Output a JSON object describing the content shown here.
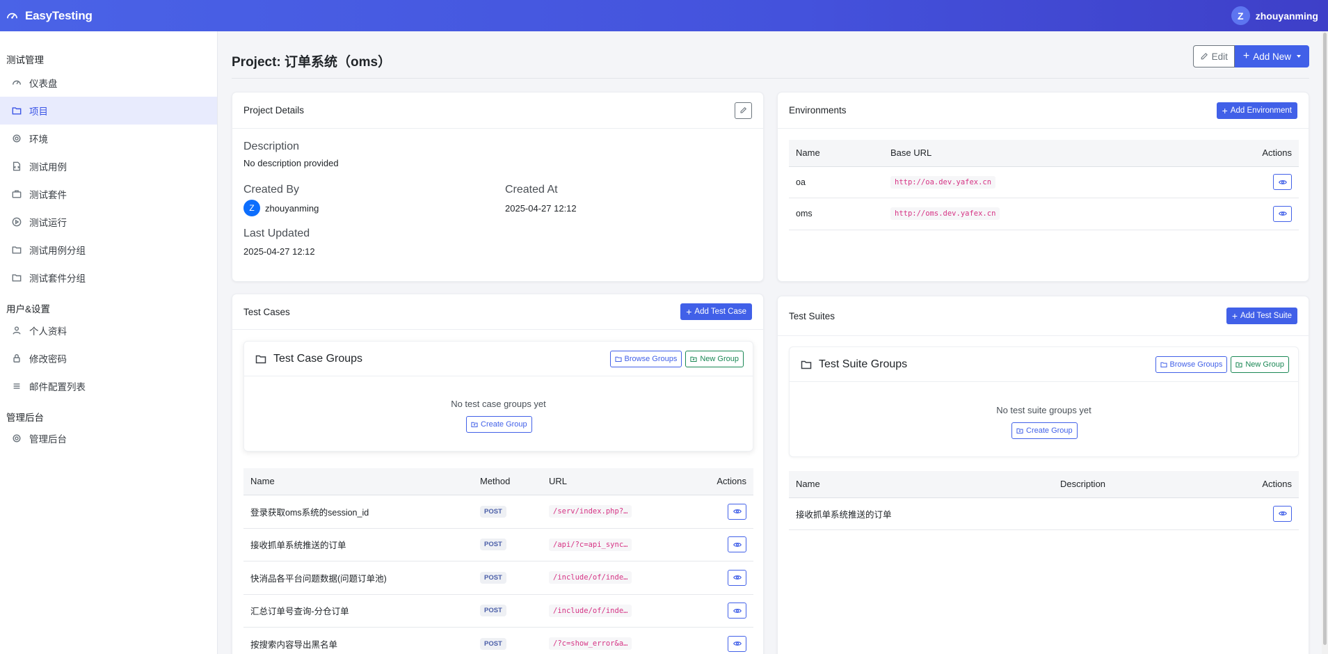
{
  "app": {
    "brand": "EasyTesting",
    "user_initial": "Z",
    "username": "zhouyanming"
  },
  "sidebar": {
    "sections": [
      {
        "title": "测试管理",
        "items": [
          {
            "label": "仪表盘",
            "icon": "dashboard-icon"
          },
          {
            "label": "项目",
            "icon": "folder-icon",
            "active": true
          },
          {
            "label": "环境",
            "icon": "gear-icon"
          },
          {
            "label": "测试用例",
            "icon": "file-code-icon"
          },
          {
            "label": "测试套件",
            "icon": "suitcase-icon"
          },
          {
            "label": "测试运行",
            "icon": "play-circle-icon"
          },
          {
            "label": "测试用例分组",
            "icon": "folder-icon"
          },
          {
            "label": "测试套件分组",
            "icon": "folder-icon"
          }
        ]
      },
      {
        "title": "用户&设置",
        "items": [
          {
            "label": "个人资料",
            "icon": "person-icon"
          },
          {
            "label": "修改密码",
            "icon": "lock-icon"
          },
          {
            "label": "邮件配置列表",
            "icon": "list-icon"
          }
        ]
      },
      {
        "title": "管理后台",
        "items": [
          {
            "label": "管理后台",
            "icon": "gear-icon"
          }
        ]
      }
    ]
  },
  "page": {
    "title": "Project: 订单系统（oms）",
    "edit_label": "Edit",
    "add_new_label": "Add New"
  },
  "details": {
    "title": "Project Details",
    "description_label": "Description",
    "description_value": "No description provided",
    "created_by_label": "Created By",
    "created_by_initial": "Z",
    "created_by_value": "zhouyanming",
    "created_at_label": "Created At",
    "created_at_value": "2025-04-27 12:12",
    "updated_label": "Last Updated",
    "updated_value": "2025-04-27 12:12"
  },
  "environments": {
    "title": "Environments",
    "add_label": "Add Environment",
    "columns": [
      "Name",
      "Base URL",
      "Actions"
    ],
    "rows": [
      {
        "name": "oa",
        "url": "http://oa.dev.yafex.cn"
      },
      {
        "name": "oms",
        "url": "http://oms.dev.yafex.cn"
      }
    ]
  },
  "test_cases": {
    "title": "Test Cases",
    "add_label": "Add Test Case",
    "groups": {
      "title": "Test Case Groups",
      "browse_label": "Browse Groups",
      "new_label": "New Group",
      "empty_text": "No test case groups yet",
      "create_label": "Create Group"
    },
    "columns": [
      "Name",
      "Method",
      "URL",
      "Actions"
    ],
    "rows": [
      {
        "name": "登录获取oms系统的session_id",
        "method": "POST",
        "url": "/serv/index.php?…"
      },
      {
        "name": "接收抓单系统推送的订单",
        "method": "POST",
        "url": "/api/?c=api_sync…"
      },
      {
        "name": "快消品各平台问题数据(问题订单池)",
        "method": "POST",
        "url": "/include/of/inde…"
      },
      {
        "name": "汇总订单号查询-分仓订单",
        "method": "POST",
        "url": "/include/of/inde…"
      },
      {
        "name": "按搜索内容导出黑名单",
        "method": "POST",
        "url": "/?c=show_error&a…"
      }
    ]
  },
  "test_suites": {
    "title": "Test Suites",
    "add_label": "Add Test Suite",
    "groups": {
      "title": "Test Suite Groups",
      "browse_label": "Browse Groups",
      "new_label": "New Group",
      "empty_text": "No test suite groups yet",
      "create_label": "Create Group"
    },
    "columns": [
      "Name",
      "Description",
      "Actions"
    ],
    "rows": [
      {
        "name": "接收抓单系统推送的订单",
        "description": ""
      }
    ]
  }
}
